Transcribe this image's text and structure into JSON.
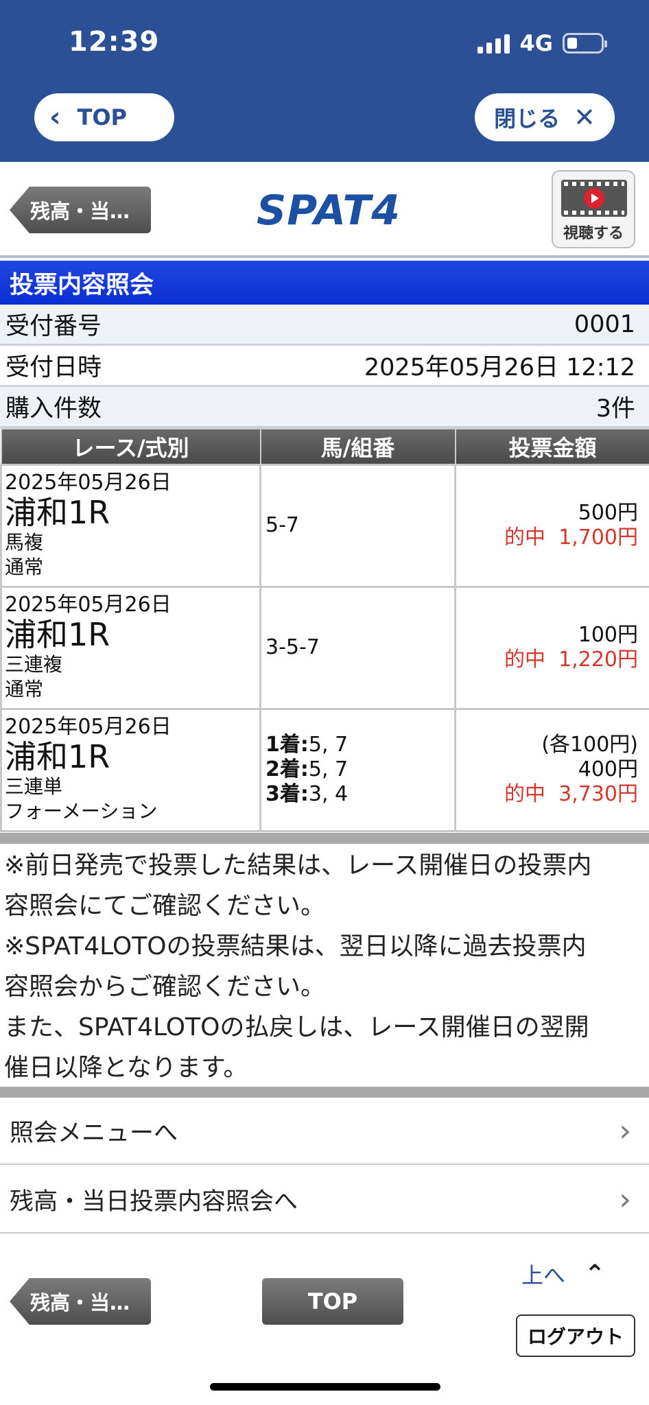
{
  "status_bar": {
    "time": "12:39",
    "network": "4G"
  },
  "browser": {
    "top_label": "TOP",
    "close_label": "閉じる"
  },
  "header": {
    "back_label": "残高・当…",
    "logo": "SPAT4",
    "watch_label": "視聴する"
  },
  "page_title": "投票内容照会",
  "info_rows": [
    {
      "label": "受付番号",
      "value": "0001"
    },
    {
      "label": "受付日時",
      "value": "2025年05月26日 12:12"
    },
    {
      "label": "購入件数",
      "value": "3件"
    }
  ],
  "table": {
    "headers": [
      "レース/式別",
      "馬/組番",
      "投票金額"
    ],
    "rows": [
      {
        "date": "2025年05月26日",
        "race": "浦和1R",
        "bet_type": "馬複",
        "method": "通常",
        "combo": [
          {
            "label": "",
            "value": "5-7"
          }
        ],
        "each": "",
        "amount": "500円",
        "hit_label": "的中",
        "hit_amount": "1,700円"
      },
      {
        "date": "2025年05月26日",
        "race": "浦和1R",
        "bet_type": "三連複",
        "method": "通常",
        "combo": [
          {
            "label": "",
            "value": "3-5-7"
          }
        ],
        "each": "",
        "amount": "100円",
        "hit_label": "的中",
        "hit_amount": "1,220円"
      },
      {
        "date": "2025年05月26日",
        "race": "浦和1R",
        "bet_type": "三連単",
        "method": "フォーメーション",
        "combo": [
          {
            "label": "1着:",
            "value": "5, 7"
          },
          {
            "label": "2着:",
            "value": "5, 7"
          },
          {
            "label": "3着:",
            "value": "3, 4"
          }
        ],
        "each": "(各100円)",
        "amount": "400円",
        "hit_label": "的中",
        "hit_amount": "3,730円"
      }
    ]
  },
  "notes": [
    "※前日発売で投票した結果は、レース開催日の投票内",
    "容照会にてご確認ください。",
    "※SPAT4LOTOの投票結果は、翌日以降に過去投票内",
    "容照会からご確認ください。",
    "また、SPAT4LOTOの払戻しは、レース開催日の翌開",
    "催日以降となります。"
  ],
  "menu_links": [
    "照会メニューへ",
    "残高・当日投票内容照会へ"
  ],
  "footer": {
    "back_label": "残高・当…",
    "top_label": "TOP",
    "to_top_label": "上へ",
    "logout_label": "ログアウト"
  },
  "colors": {
    "chrome_blue": "#2b5096",
    "title_blue": "#0a2fd0",
    "hit_red": "#d6372e"
  }
}
